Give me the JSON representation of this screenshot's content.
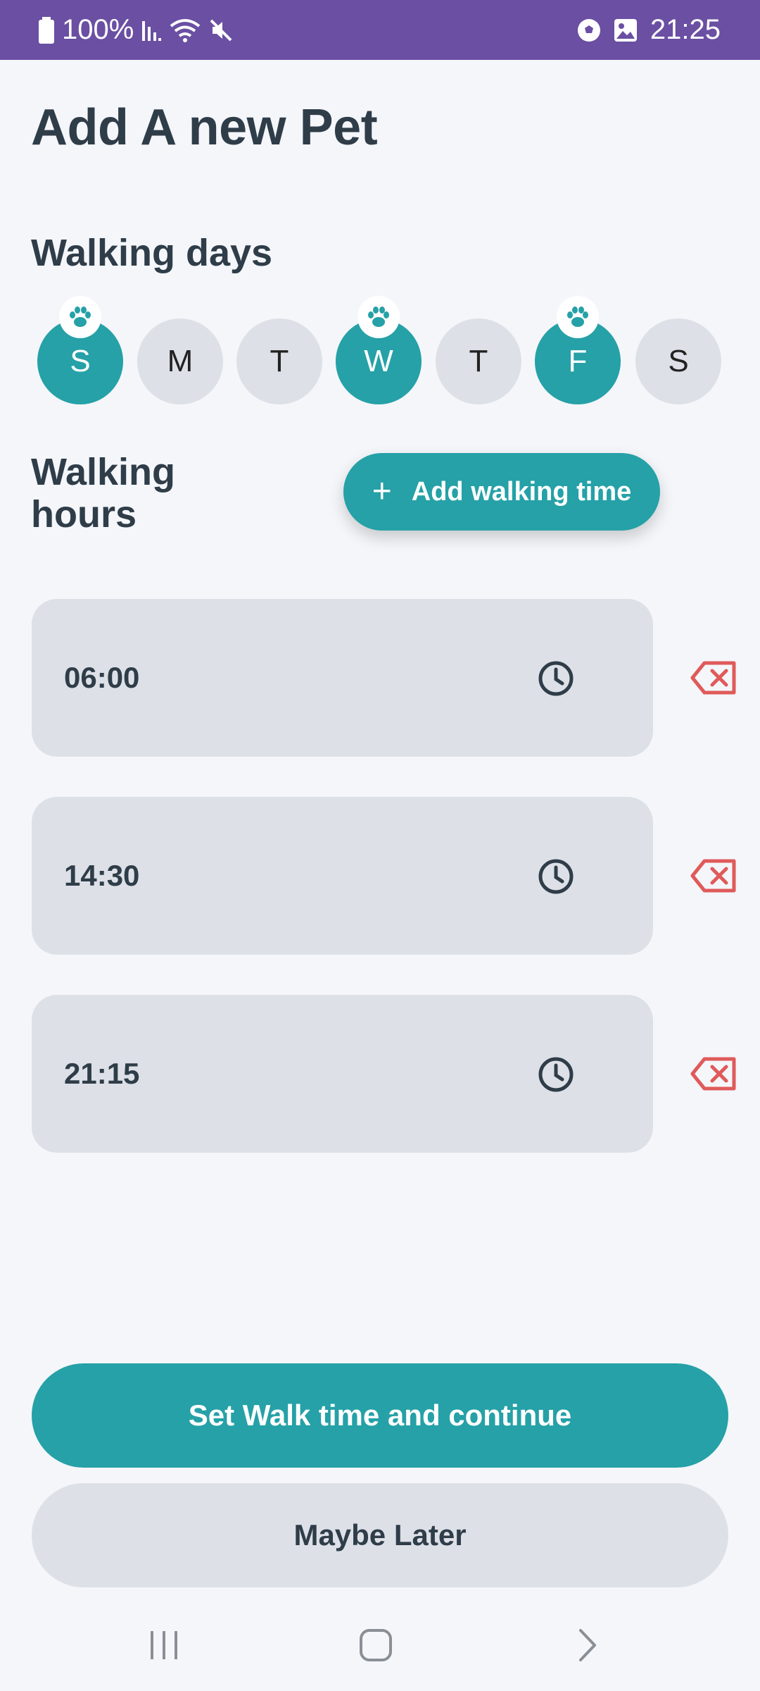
{
  "status_bar": {
    "battery_percent": "100%",
    "time": "21:25",
    "icons": [
      "battery-icon",
      "signal-icon",
      "wifi-icon",
      "mute-icon",
      "soccer-ball-icon",
      "gallery-icon"
    ]
  },
  "page": {
    "title": "Add A new Pet"
  },
  "walking_days": {
    "title": "Walking days",
    "days": [
      {
        "label": "S",
        "selected": true
      },
      {
        "label": "M",
        "selected": false
      },
      {
        "label": "T",
        "selected": false
      },
      {
        "label": "W",
        "selected": true
      },
      {
        "label": "T",
        "selected": false
      },
      {
        "label": "F",
        "selected": true
      },
      {
        "label": "S",
        "selected": false
      }
    ]
  },
  "walking_hours": {
    "title": "Walking hours",
    "add_button_label": "Add walking time",
    "times": [
      "06:00",
      "14:30",
      "21:15"
    ]
  },
  "actions": {
    "primary_label": "Set Walk time and continue",
    "secondary_label": "Maybe Later"
  },
  "colors": {
    "accent": "#25a1a7",
    "status_bar": "#6a4fa3",
    "delete": "#e05a5a",
    "field_bg": "#dde1e7",
    "text": "#2f3d49"
  }
}
